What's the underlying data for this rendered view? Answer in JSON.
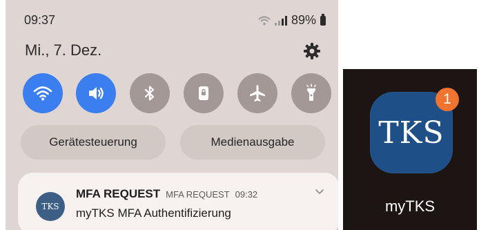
{
  "status_bar": {
    "time": "09:37",
    "battery_percent": "89%",
    "icons": [
      "wifi-icon",
      "signal-icon",
      "battery-icon"
    ]
  },
  "header": {
    "date": "Mi., 7. Dez.",
    "settings_icon": "gear-icon"
  },
  "quick_settings": {
    "tiles": [
      {
        "icon": "wifi-icon",
        "state": "on"
      },
      {
        "icon": "sound-icon",
        "state": "on"
      },
      {
        "icon": "bluetooth-icon",
        "state": "off"
      },
      {
        "icon": "lock-rotation-icon",
        "state": "off"
      },
      {
        "icon": "airplane-icon",
        "state": "off"
      },
      {
        "icon": "flashlight-icon",
        "state": "off"
      }
    ],
    "device_control_label": "Gerätesteuerung",
    "media_output_label": "Medienausgabe",
    "active_color": "#3b7ef0",
    "inactive_color": "#a39896"
  },
  "notification": {
    "avatar_text": "TKS",
    "title": "MFA REQUEST",
    "app_name": "MFA REQUEST",
    "time": "09:32",
    "body": "myTKS MFA Authentifizierung",
    "avatar_color": "#3d5f86"
  },
  "app": {
    "icon_text": "TKS",
    "badge_count": "1",
    "label": "myTKS",
    "icon_color": "#1e4f86",
    "badge_color": "#f0742f"
  }
}
